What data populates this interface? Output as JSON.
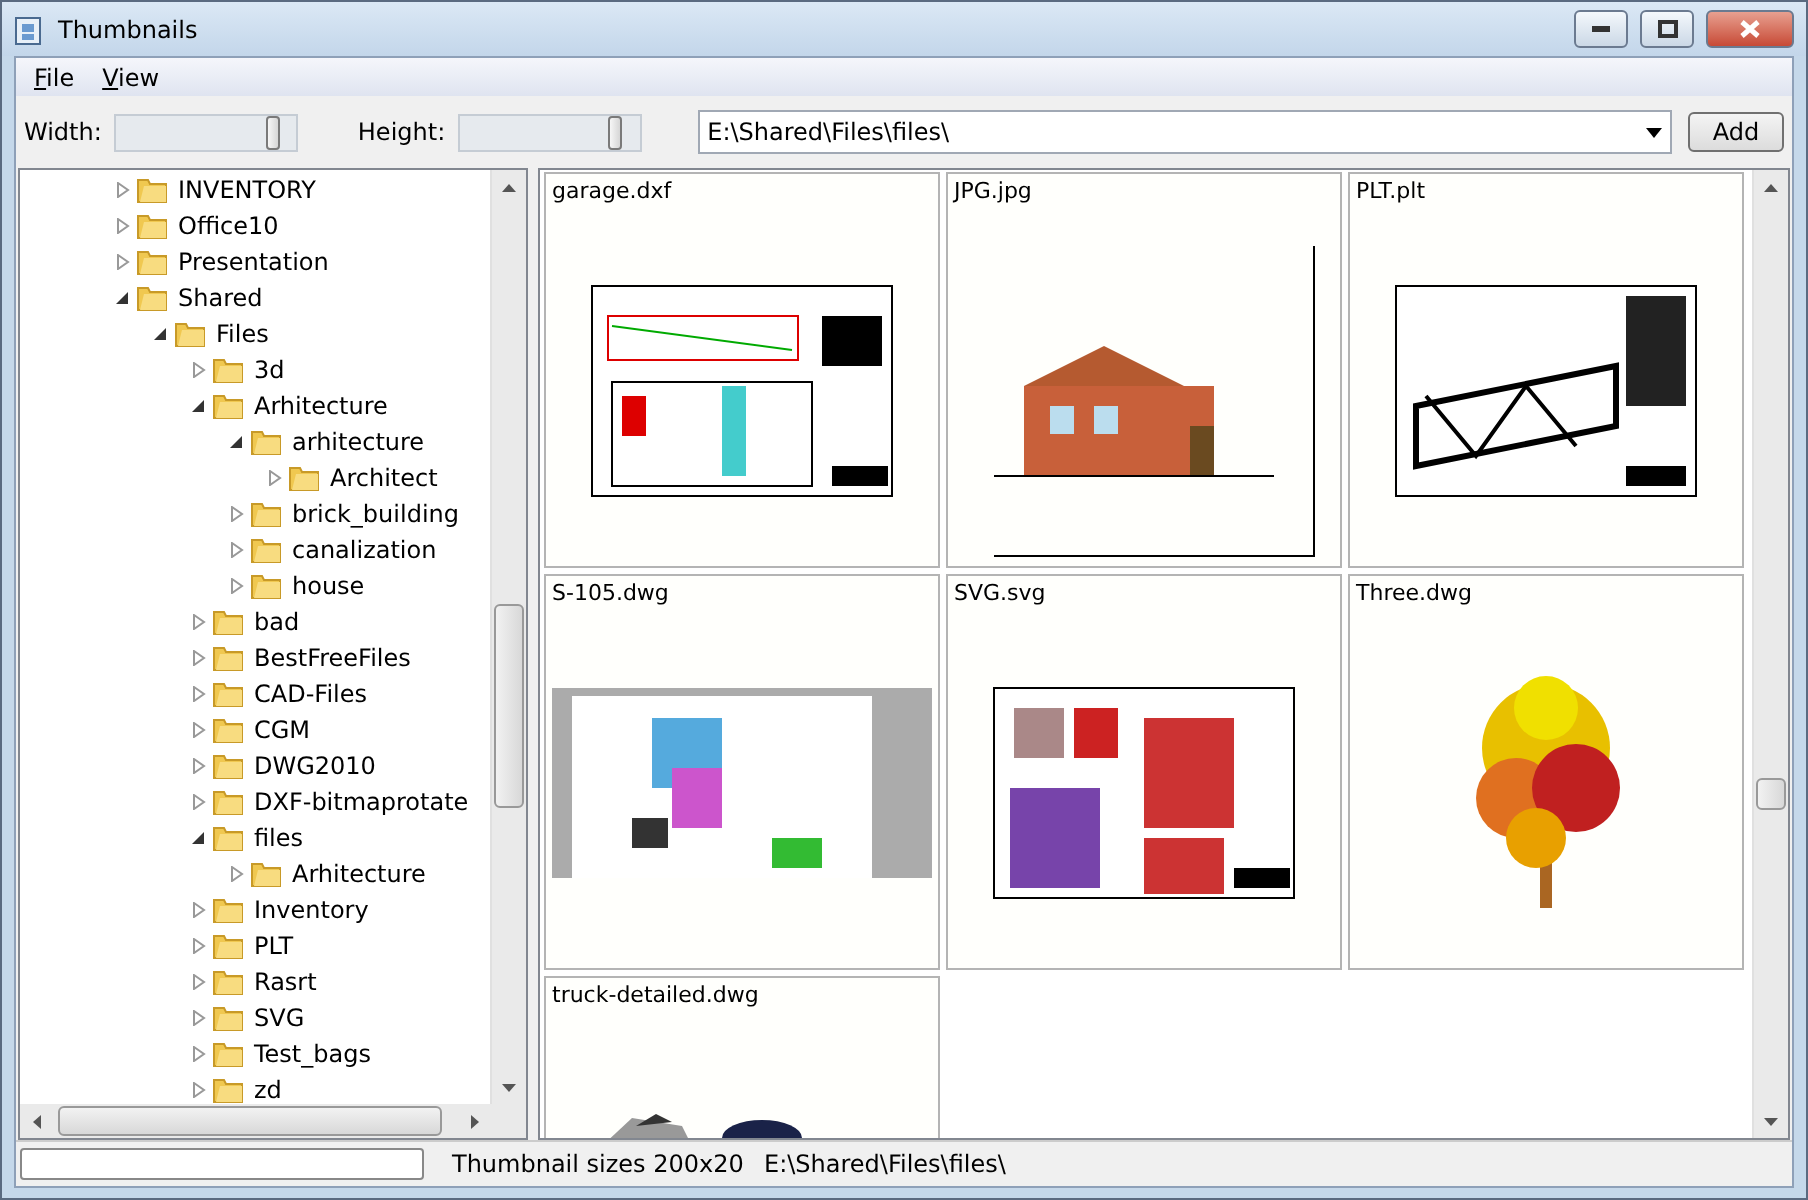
{
  "window": {
    "title": "Thumbnails"
  },
  "menu": [
    {
      "label": "File"
    },
    {
      "label": "View"
    }
  ],
  "toolbar": {
    "width_label": "Width:",
    "width_slider": {
      "level": 0.9
    },
    "height_label": "Height:",
    "height_slider": {
      "level": 0.9
    },
    "path": "E:\\Shared\\Files\\files\\",
    "add": "Add"
  },
  "tree": [
    {
      "label": "INVENTORY",
      "expanded": false
    },
    {
      "label": "Office10",
      "expanded": false
    },
    {
      "label": "Presentation",
      "expanded": false
    },
    {
      "label": "Shared",
      "expanded": true,
      "children": [
        {
          "label": "Files",
          "expanded": true,
          "children": [
            {
              "label": "3d",
              "expanded": false
            },
            {
              "label": "Arhitecture",
              "expanded": true,
              "children": [
                {
                  "label": "arhitecture",
                  "expanded": true,
                  "children": [
                    {
                      "label": "Architect",
                      "expanded": false
                    }
                  ]
                },
                {
                  "label": "brick_building",
                  "expanded": false
                },
                {
                  "label": "canalization",
                  "expanded": false
                },
                {
                  "label": "house",
                  "expanded": false
                }
              ]
            },
            {
              "label": "bad",
              "expanded": false
            },
            {
              "label": "BestFreeFiles",
              "expanded": false
            },
            {
              "label": "CAD-Files",
              "expanded": false
            },
            {
              "label": "CGM",
              "expanded": false
            },
            {
              "label": "DWG2010",
              "expanded": false
            },
            {
              "label": "DXF-bitmaprotate",
              "expanded": false
            },
            {
              "label": "files",
              "expanded": true,
              "children": [
                {
                  "label": "Arhitecture",
                  "expanded": false
                }
              ]
            },
            {
              "label": "Inventory",
              "expanded": false
            },
            {
              "label": "PLT",
              "expanded": false
            },
            {
              "label": "Rasrt",
              "expanded": false
            },
            {
              "label": "SVG",
              "expanded": false
            },
            {
              "label": "Test_bags",
              "expanded": false
            },
            {
              "label": "zd",
              "expanded": false
            }
          ]
        }
      ]
    }
  ],
  "thumbnails": [
    {
      "name": "garage.dxf",
      "kind": "picture"
    },
    {
      "name": "JPG.jpg",
      "kind": "picture"
    },
    {
      "name": "PLT.plt",
      "kind": "picture"
    },
    {
      "name": "S-105.dwg",
      "kind": "picture"
    },
    {
      "name": "SVG.svg",
      "kind": "picture"
    },
    {
      "name": "Three.dwg",
      "kind": "picture"
    },
    {
      "name": "truck-detailed.dwg",
      "kind": "picture"
    }
  ],
  "status_bar": {
    "sizes": "Thumbnail sizes 200x20",
    "path": "E:\\Shared\\Files\\files\\"
  }
}
